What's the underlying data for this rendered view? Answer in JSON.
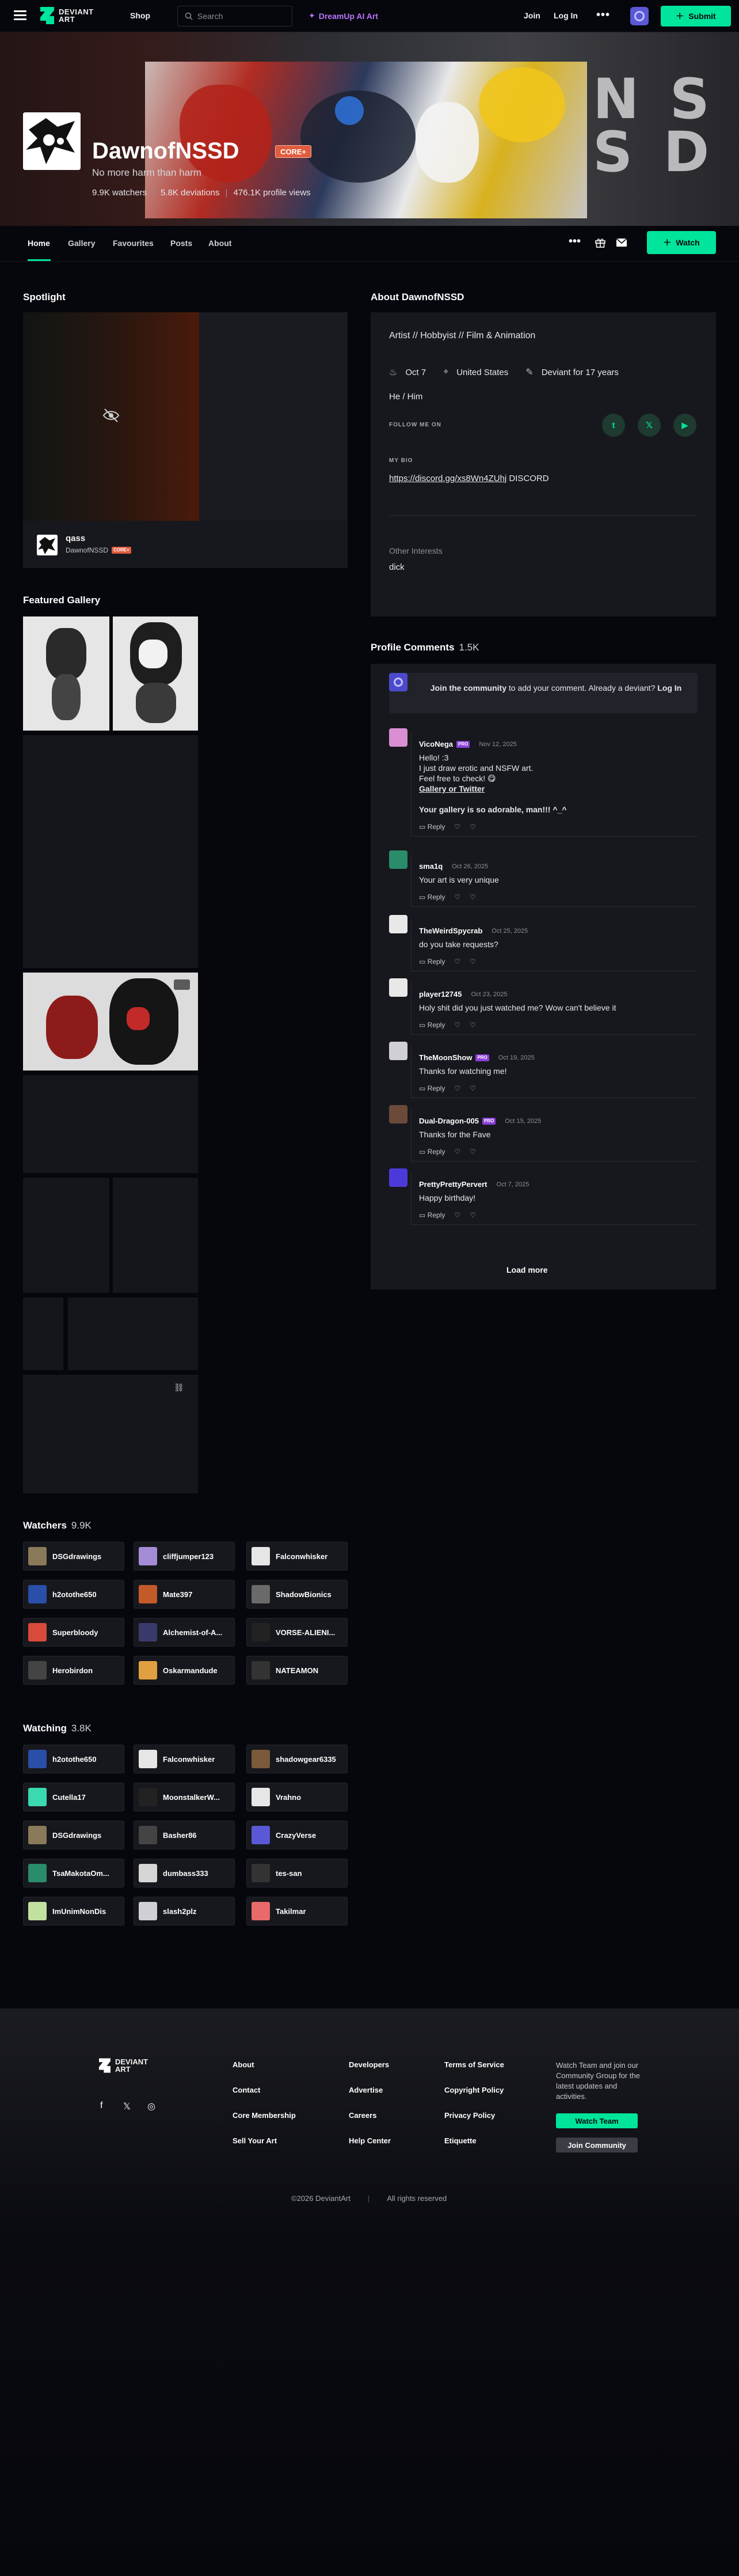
{
  "topnav": {
    "logo_line1": "DEVIANT",
    "logo_line2": "ART",
    "shop": "Shop",
    "search_placeholder": "Search",
    "dreamup": "DreamUp AI Art",
    "join": "Join",
    "login": "Log In",
    "submit": "Submit"
  },
  "profile": {
    "name": "DawnofNSSD",
    "core_badge": "CORE+",
    "tagline": "No more harm than harm",
    "watchers": "9.9K watchers",
    "deviations": "5.8K deviations",
    "views": "476.1K profile views",
    "hero_text": "NSSD"
  },
  "tabs": [
    "Home",
    "Gallery",
    "Favourites",
    "Posts",
    "About"
  ],
  "watch_button": "Watch",
  "spotlight": {
    "heading": "Spotlight",
    "title": "qass",
    "author": "DawnofNSSD",
    "badge": "CORE+"
  },
  "featured": {
    "heading": "Featured Gallery"
  },
  "about": {
    "heading": "About DawnofNSSD",
    "tags": "Artist  //  Hobbyist  //  Film & Animation",
    "birthday": "Oct 7",
    "location": "United States",
    "deviant_for": "Deviant for 17 years",
    "pronouns": "He / Him",
    "follow_label": "FOLLOW ME ON",
    "bio_label": "MY BIO",
    "bio_link": "https://discord.gg/xs8Wn4ZUhj",
    "bio_rest": " DISCORD",
    "interests_label": "Other Interests",
    "interests": "dick"
  },
  "comments": {
    "heading": "Profile Comments",
    "count": "1.5K",
    "join_bold": "Join the community",
    "join_text": " to add your comment. Already a deviant? ",
    "join_login": "Log In",
    "reply": "Reply",
    "load_more": "Load more",
    "items": [
      {
        "author": "VicoNega",
        "pro": "PRO",
        "date": "Nov 12, 2025",
        "lines": [
          "Hello! :3",
          "I just draw erotic and NSFW art.",
          "Feel free to check! 😋",
          "Gallery or Twitter",
          "",
          "Your gallery is so adorable, man!!! ^_^"
        ]
      },
      {
        "author": "sma1q",
        "pro": "",
        "date": "Oct 26, 2025",
        "lines": [
          "Your art is very unique"
        ]
      },
      {
        "author": "TheWeirdSpycrab",
        "pro": "",
        "date": "Oct 25, 2025",
        "lines": [
          "do you take requests?"
        ]
      },
      {
        "author": "player12745",
        "pro": "",
        "date": "Oct 23, 2025",
        "lines": [
          "Holy shit did you just watched me? Wow can't believe it"
        ]
      },
      {
        "author": "TheMoonShow",
        "pro": "PRO",
        "date": "Oct 19, 2025",
        "lines": [
          "Thanks for watching me!"
        ]
      },
      {
        "author": "Dual-Dragon-005",
        "pro": "PRO",
        "date": "Oct 15, 2025",
        "lines": [
          "Thanks for the Fave"
        ]
      },
      {
        "author": "PrettyPrettyPervert",
        "pro": "",
        "date": "Oct 7, 2025",
        "lines": [
          "Happy birthday!"
        ]
      }
    ]
  },
  "watchers": {
    "heading": "Watchers",
    "count": "9.9K",
    "items": [
      "DSGdrawings",
      "cliffjumper123",
      "Falconwhisker",
      "h2otothe650",
      "Mate397",
      "ShadowBionics",
      "Superbloody",
      "Alchemist-of-A...",
      "VORSE-ALIENI...",
      "Herobirdon",
      "Oskarmandude",
      "NATEAMON"
    ]
  },
  "watching": {
    "heading": "Watching",
    "count": "3.8K",
    "items": [
      "h2otothe650",
      "Falconwhisker",
      "shadowgear6335",
      "Cutella17",
      "MoonstalkerW...",
      "Vrahno",
      "DSGdrawings",
      "Basher86",
      "CrazyVerse",
      "TsaMakotaOm...",
      "dumbass333",
      "tes-san",
      "ImUnimNonDis",
      "slash2plz",
      "Takilmar"
    ]
  },
  "footer": {
    "logo_line1": "DEVIANT",
    "logo_line2": "ART",
    "col1": [
      "About",
      "Contact",
      "Core Membership",
      "Sell Your Art"
    ],
    "col2": [
      "Developers",
      "Advertise",
      "Careers",
      "Help Center"
    ],
    "col3": [
      "Terms of Service",
      "Copyright Policy",
      "Privacy Policy",
      "Etiquette"
    ],
    "watch_text": "Watch  Team and join our Community Group for the latest updates and activities.",
    "watch_team": "Watch Team",
    "join_community": "Join Community",
    "copyright": "©2026 DeviantArt",
    "rights": "All rights reserved"
  },
  "colors": {
    "accent": "#00e59b",
    "core": "#e05c3d",
    "pro": "#8b3fd9",
    "dreamup": "#b975ff"
  }
}
